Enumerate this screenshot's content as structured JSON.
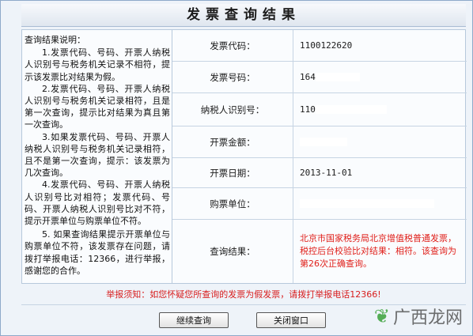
{
  "page": {
    "title": "发票查询结果"
  },
  "notes": {
    "heading": "查询结果说明：",
    "items": [
      "1.发票代码、号码、开票人纳税人识别号与税务机关记录不相符，提示该发票比对结果为假。",
      "2.发票代码、号码、开票人纳税人识别号与税务机关记录相符，且是第一次查询，提示比对结果为真且第一次查询。",
      "3.如果发票代码、号码、开票人纳税人识别号与税务机关记录相符，且不是第一次查询，提示：该发票为几次查询。",
      "4.发票代码、号码、开票人纳税人识别号比对相符；发票代码、号码、开票人纳税人识别号比对不符，提示开票单位与购票单位不符。",
      "5. 如果查询结果提示开票单位与购票单位不符，该发票存在问题，请拨打举报电话：12366，进行举报，感谢您的合作。"
    ]
  },
  "fields": {
    "code": {
      "label": "发票代码：",
      "value": "1100122620"
    },
    "number": {
      "label": "发票号码：",
      "value": "164"
    },
    "taxpayer": {
      "label": "纳税人识别号：",
      "value": "110"
    },
    "amount": {
      "label": "开票金额：",
      "value": ""
    },
    "date": {
      "label": "开票日期：",
      "value": "2013-11-01"
    },
    "buyer": {
      "label": "购票单位：",
      "value": ""
    },
    "result": {
      "label": "查询结果：",
      "value": "北京市国家税务局北京增值税普通发票，税控后台校验比对结果：相符。该查询为第26次正确查询。"
    }
  },
  "report_notice": "举报须知：如您怀疑您所查询的发票为假发票，请拨打举报电话12366!",
  "buttons": {
    "continue": "继续查询",
    "close": "关闭窗口"
  },
  "watermark": {
    "text": "广西龙网",
    "icon": "leaf-icon"
  },
  "colors": {
    "result_red": "#e0201b",
    "notice_red": "#d81e1e",
    "border_blue": "#b7c9dc"
  }
}
